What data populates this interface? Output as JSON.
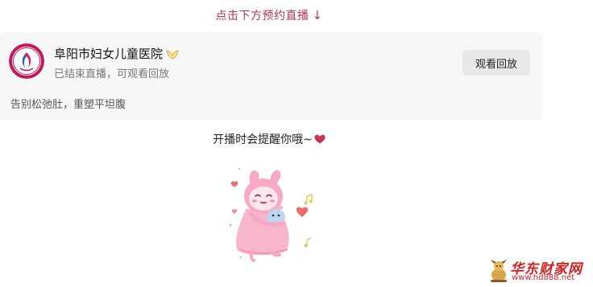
{
  "header": {
    "hint_text": "点击下方预约直播",
    "hint_arrow": "↓"
  },
  "live_card": {
    "hospital_name": "阜阳市妇女儿童医院",
    "logo_icon": "hospital-logo",
    "verified_icon": "verified-badge-icon",
    "status_text": "已结束直播，可观看回放",
    "replay_button_label": "观看回放",
    "live_title": "告别松弛肚，重塑平坦腹"
  },
  "reminder": {
    "text": "开播时会提醒你哦~",
    "icon": "heart-icon"
  },
  "illustration": {
    "icon": "pink-mascot-hugging-illustration"
  },
  "watermark": {
    "site_name": "华东财家网",
    "url": "www.hd888.net"
  },
  "colors": {
    "accent": "#b03556",
    "card_bg": "#f7f7f7",
    "button_bg": "#e8e8e8",
    "heart": "#c8334f",
    "watermark": "#d11f1f"
  }
}
